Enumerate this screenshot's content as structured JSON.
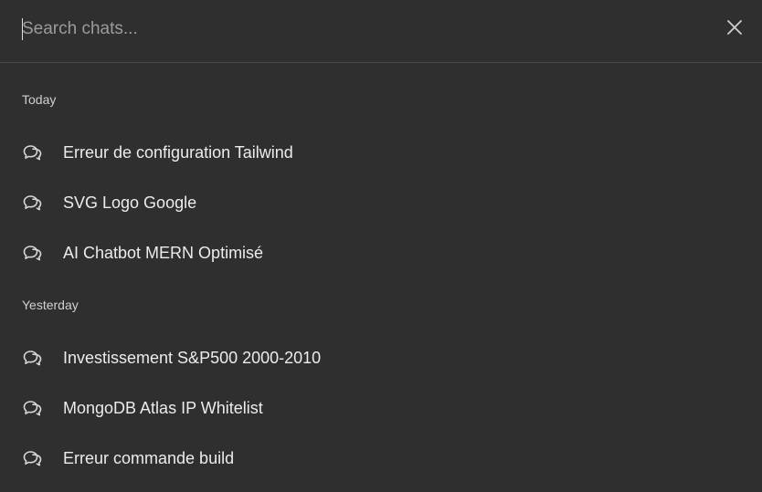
{
  "search": {
    "placeholder": "Search chats...",
    "value": ""
  },
  "sections": [
    {
      "label": "Today",
      "items": [
        {
          "label": "Erreur de configuration Tailwind",
          "icon": "chat-bubbles-icon"
        },
        {
          "label": "SVG Logo Google",
          "icon": "chat-bubbles-icon"
        },
        {
          "label": "AI Chatbot MERN Optimisé",
          "icon": "chat-bubbles-icon"
        }
      ]
    },
    {
      "label": "Yesterday",
      "items": [
        {
          "label": "Investissement S&P500 2000-2010",
          "icon": "chat-bubbles-icon"
        },
        {
          "label": "MongoDB Atlas IP Whitelist",
          "icon": "chat-bubbles-icon"
        },
        {
          "label": "Erreur commande build",
          "icon": "chat-bubbles-icon"
        }
      ]
    }
  ],
  "colors": {
    "background": "#2f2f2f",
    "text": "#ececec",
    "divider": "#4a4a4a"
  }
}
